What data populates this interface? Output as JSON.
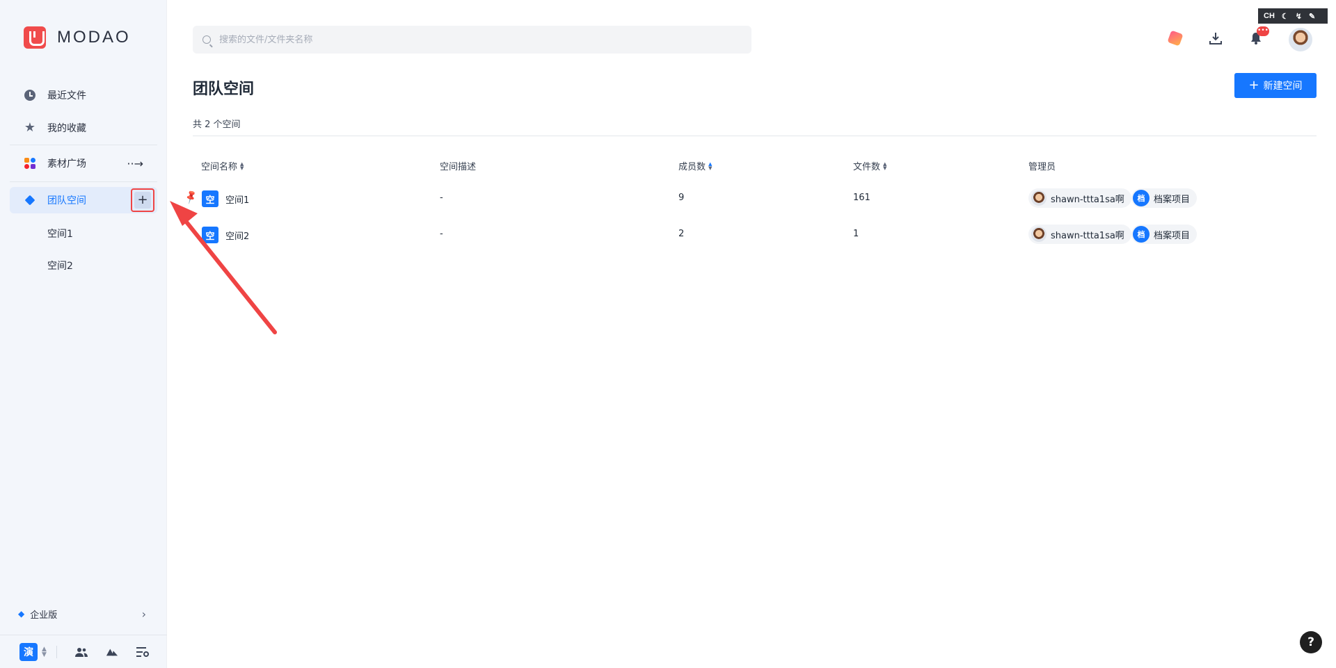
{
  "brand": {
    "name": "MODAO"
  },
  "sidebar": {
    "recent": "最近文件",
    "favorites": "我的收藏",
    "assets": "素材广场",
    "assets_arrow": "··→",
    "team_space": "团队空间",
    "add_label": "+",
    "sub_spaces": [
      "空间1",
      "空间2"
    ],
    "enterprise": "企业版",
    "team_badge": "演"
  },
  "search": {
    "placeholder": "搜索的文件/文件夹名称"
  },
  "header": {
    "notification_badge": "•••",
    "toolbar_label": "CH"
  },
  "page": {
    "title": "团队空间",
    "new_button": "新建空间",
    "count_text": "共 2 个空间"
  },
  "table": {
    "columns": [
      "空间名称",
      "空间描述",
      "成员数",
      "文件数",
      "管理员"
    ],
    "rows": [
      {
        "icon": "空",
        "name": "空间1",
        "desc": "-",
        "members": "9",
        "files": "161",
        "pinned": true,
        "admins": [
          "shawn-ttta1sa啊",
          "档案项目"
        ],
        "admin_letter": "档"
      },
      {
        "icon": "空",
        "name": "空间2",
        "desc": "-",
        "members": "2",
        "files": "1",
        "pinned": false,
        "admins": [
          "shawn-ttta1sa啊",
          "档案项目"
        ],
        "admin_letter": "档"
      }
    ]
  },
  "help": {
    "label": "?"
  },
  "colors": {
    "accent": "#1677ff",
    "highlight": "#ef4444",
    "pin": "#f5b400"
  }
}
